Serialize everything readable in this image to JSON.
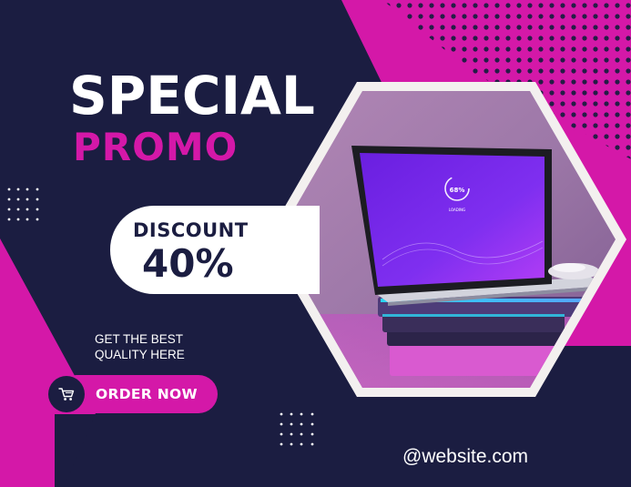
{
  "banner": {
    "title": "SPECIAL",
    "subtitle": "PROMO",
    "discount": {
      "label": "DISCOUNT",
      "value": "40%"
    },
    "tagline": {
      "line1": "GET THE BEST",
      "line2": "QUALITY HERE"
    },
    "order_button": {
      "label": "ORDER NOW",
      "icon": "shopping-cart-icon"
    },
    "website": "@website.com"
  },
  "photo": {
    "subject": "laptop-on-book-stack",
    "screen": {
      "percent": "68%",
      "caption": "LOADING"
    }
  },
  "colors": {
    "background": "#1b1d41",
    "accent": "#d418a8",
    "text": "#ffffff",
    "frame": "#f3f0ef"
  }
}
